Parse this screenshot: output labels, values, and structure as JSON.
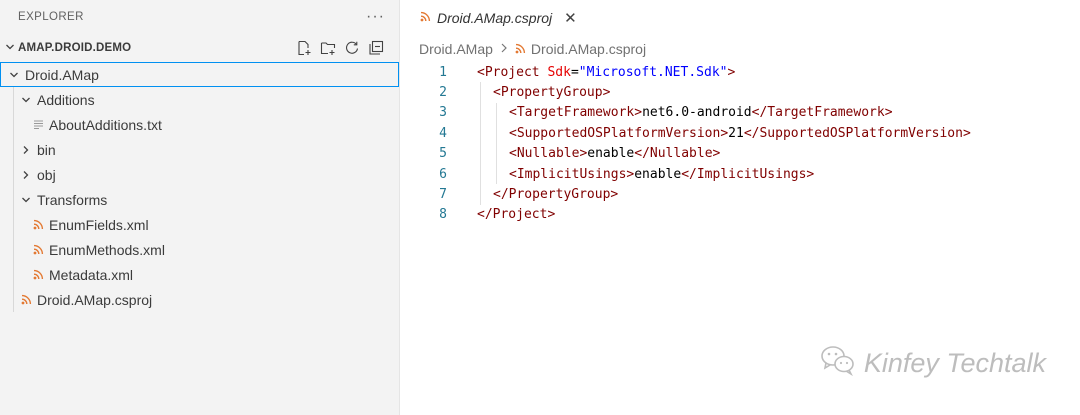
{
  "explorer": {
    "title": "EXPLORER",
    "more": "···",
    "section_title": "AMAP.DROID.DEMO"
  },
  "tree": [
    {
      "label": "Droid.AMap",
      "depth": 0,
      "type": "folder",
      "expanded": true
    },
    {
      "label": "Additions",
      "depth": 1,
      "type": "folder",
      "expanded": true
    },
    {
      "label": "AboutAdditions.txt",
      "depth": 2,
      "type": "txt"
    },
    {
      "label": "bin",
      "depth": 1,
      "type": "folder",
      "expanded": false
    },
    {
      "label": "obj",
      "depth": 1,
      "type": "folder",
      "expanded": false
    },
    {
      "label": "Transforms",
      "depth": 1,
      "type": "folder",
      "expanded": true
    },
    {
      "label": "EnumFields.xml",
      "depth": 2,
      "type": "xml"
    },
    {
      "label": "EnumMethods.xml",
      "depth": 2,
      "type": "xml"
    },
    {
      "label": "Metadata.xml",
      "depth": 2,
      "type": "xml"
    },
    {
      "label": "Droid.AMap.csproj",
      "depth": 1,
      "type": "xml"
    }
  ],
  "tab": {
    "label": "Droid.AMap.csproj"
  },
  "breadcrumbs": {
    "folder": "Droid.AMap",
    "file": "Droid.AMap.csproj"
  },
  "code": [
    {
      "n": "1",
      "indent": 0,
      "tokens": [
        [
          "tag",
          "<Project "
        ],
        [
          "attr",
          "Sdk"
        ],
        [
          "txt",
          "="
        ],
        [
          "str",
          "\"Microsoft.NET.Sdk\""
        ],
        [
          "tag",
          ">"
        ]
      ]
    },
    {
      "n": "2",
      "indent": 1,
      "tokens": [
        [
          "tag",
          "<PropertyGroup>"
        ]
      ]
    },
    {
      "n": "3",
      "indent": 2,
      "tokens": [
        [
          "tag",
          "<TargetFramework>"
        ],
        [
          "txt",
          "net6.0-android"
        ],
        [
          "tag",
          "</TargetFramework>"
        ]
      ]
    },
    {
      "n": "4",
      "indent": 2,
      "tokens": [
        [
          "tag",
          "<SupportedOSPlatformVersion>"
        ],
        [
          "txt",
          "21"
        ],
        [
          "tag",
          "</SupportedOSPlatformVersion>"
        ]
      ]
    },
    {
      "n": "5",
      "indent": 2,
      "tokens": [
        [
          "tag",
          "<Nullable>"
        ],
        [
          "txt",
          "enable"
        ],
        [
          "tag",
          "</Nullable>"
        ]
      ]
    },
    {
      "n": "6",
      "indent": 2,
      "tokens": [
        [
          "tag",
          "<ImplicitUsings>"
        ],
        [
          "txt",
          "enable"
        ],
        [
          "tag",
          "</ImplicitUsings>"
        ]
      ]
    },
    {
      "n": "7",
      "indent": 1,
      "tokens": [
        [
          "tag",
          "</PropertyGroup>"
        ]
      ]
    },
    {
      "n": "8",
      "indent": 0,
      "tokens": [
        [
          "tag",
          "</Project>"
        ]
      ]
    }
  ],
  "watermark": {
    "text": "Kinfey Techtalk"
  },
  "colors": {
    "accent": "#0090f1",
    "xml_icon": "#e37933",
    "line_number": "#237893"
  }
}
